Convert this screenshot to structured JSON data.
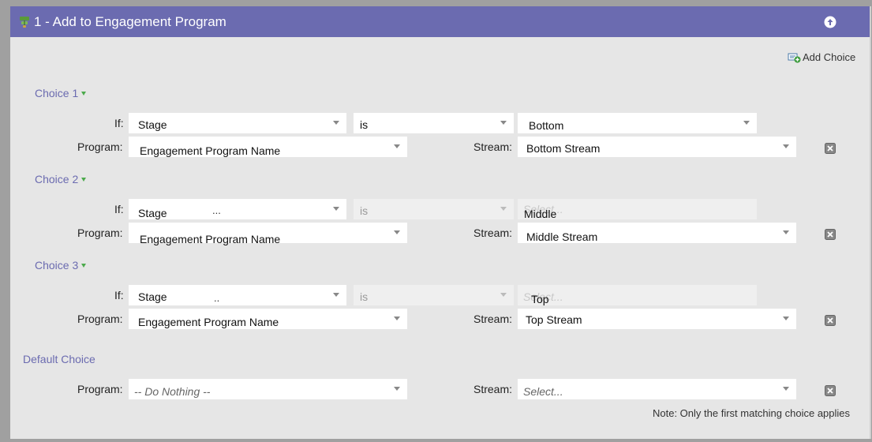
{
  "header": {
    "title": "1 - Add to Engagement Program",
    "flow_icon": "flow-step-icon",
    "collapse_icon": "collapse-up-icon"
  },
  "add_choice": {
    "label": "Add Choice",
    "icon": "add-choice-icon"
  },
  "labels": {
    "if": "If:",
    "program": "Program:",
    "stream": "Stream:"
  },
  "choices": [
    {
      "label": "Choice 1",
      "if_field": "Stage",
      "operator": "is",
      "value": "Bottom",
      "program": "Engagement Program Name",
      "stream": "Bottom Stream"
    },
    {
      "label": "Choice 2",
      "if_field": "Stage",
      "if_dots": "...",
      "operator": "is",
      "value_placeholder": "Select...",
      "value_overlay": "Middle",
      "program": "Engagement Program Name",
      "stream": "Middle Stream"
    },
    {
      "label": "Choice 3",
      "if_field": "Stage",
      "if_dots": "..",
      "operator": "is",
      "value_placeholder": "Select...",
      "value_overlay": "Top",
      "program": "Engagement Program Name",
      "stream": "Top Stream"
    }
  ],
  "default_choice": {
    "label": "Default Choice",
    "program": "-- Do Nothing --",
    "stream": "Select..."
  },
  "note": "Note: Only the first matching choice applies",
  "colors": {
    "header": "#6b6bb0",
    "accent_label": "#6b6bb0",
    "triangle": "#4caa4c",
    "panel": "#e6e6e6"
  }
}
